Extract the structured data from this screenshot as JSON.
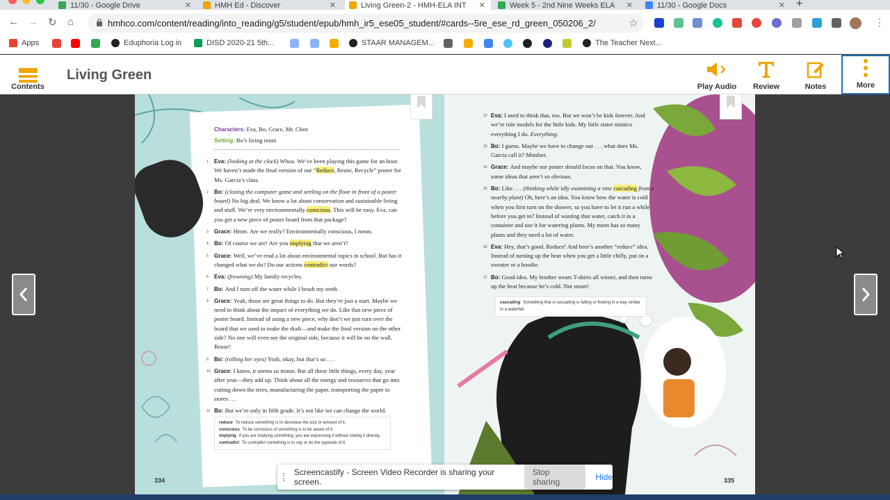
{
  "browser": {
    "tabs": [
      {
        "title": "11/30 - Google Drive",
        "favicon_color": "#34a853"
      },
      {
        "title": "HMH Ed - Discover",
        "favicon_color": "#f0a500"
      },
      {
        "title": "Living Green-2 - HMH-ELA INT",
        "favicon_color": "#f0a500"
      },
      {
        "title": "Week 5 - 2nd Nine Weeks ELA",
        "favicon_color": "#34a853"
      },
      {
        "title": "11/30 - Google Docs",
        "favicon_color": "#4285f4"
      }
    ],
    "active_tab_index": 2,
    "url": "hmhco.com/content/reading/into_reading/g5/student/epub/hmh_ir5_ese05_student/#cards--5re_ese_rd_green_050206_2/",
    "bookmarks": [
      {
        "label": "Apps",
        "icon_color": "#ea4335"
      },
      {
        "label": "Eduphoria Log in",
        "icon_color": "#202124"
      },
      {
        "label": "DISD 2020-21 5th...",
        "icon_color": "#0f9d58"
      },
      {
        "label": "STAAR MANAGEM...",
        "icon_color": "#202124"
      },
      {
        "label": "The Teacher Next...",
        "icon_color": "#202124"
      }
    ]
  },
  "app": {
    "title": "Living Green",
    "contents_label": "Contents",
    "play_audio_label": "Play Audio",
    "review_label": "Review",
    "notes_label": "Notes",
    "more_label": "More",
    "accent_color": "#f0a500"
  },
  "left_page": {
    "characters_label": "Characters:",
    "characters": "Eva, Bo, Grace, Mr. Chen",
    "setting_label": "Setting:",
    "setting": "Bo’s living room",
    "page_number": "334",
    "glossary": [
      {
        "term": "reduce",
        "def": "To reduce something is to decrease the size or amount of it."
      },
      {
        "term": "conscious",
        "def": "To be conscious of something is to be aware of it."
      },
      {
        "term": "implying",
        "def": "If you are implying something, you are expressing it without stating it directly."
      },
      {
        "term": "contradict",
        "def": "To contradict something is to say or do the opposite of it."
      }
    ],
    "lines": [
      {
        "n": "1",
        "speaker": "Eva:",
        "parts": [
          [
            "i",
            "(looking at the clock)"
          ],
          [
            "t",
            " Whoa. We’ve been playing this game for an hour. We haven’t made the final version of our “"
          ],
          [
            "h",
            "Reduce"
          ],
          [
            "t",
            ", Reuse, Recycle” poster for Ms. Garcia’s class."
          ]
        ]
      },
      {
        "n": "2",
        "speaker": "Bo:",
        "parts": [
          [
            "i",
            "(closing the computer game and settling on the floor in front of a poster board)"
          ],
          [
            "t",
            " No big deal. We know a lot about conservation and sustainable living and stuff. We’re very environmentally "
          ],
          [
            "h",
            "conscious"
          ],
          [
            "t",
            ". This will be easy. Eva, can you get a new piece of poster board from that package?"
          ]
        ]
      },
      {
        "n": "3",
        "speaker": "Grace:",
        "parts": [
          [
            "t",
            "Hmm. Are we really? Environmentally conscious, I mean."
          ]
        ]
      },
      {
        "n": "4",
        "speaker": "Bo:",
        "parts": [
          [
            "t",
            "Of course we are! Are you "
          ],
          [
            "h",
            "implying"
          ],
          [
            "t",
            " that we aren’t?"
          ]
        ]
      },
      {
        "n": "5",
        "speaker": "Grace:",
        "parts": [
          [
            "t",
            "Well, we’ve read a lot about environmental topics in school. But has it changed what we do? Do our actions "
          ],
          [
            "h",
            "contradict"
          ],
          [
            "t",
            " our words?"
          ]
        ]
      },
      {
        "n": "6",
        "speaker": "Eva:",
        "parts": [
          [
            "i",
            "(frowning)"
          ],
          [
            "t",
            " My family recycles."
          ]
        ]
      },
      {
        "n": "7",
        "speaker": "Bo:",
        "parts": [
          [
            "t",
            "And I turn off the water while I brush my teeth."
          ]
        ]
      },
      {
        "n": "8",
        "speaker": "Grace:",
        "parts": [
          [
            "t",
            "Yeah, those are great things to do. But they’re just a start. Maybe we need to think about the impact of everything we do. Like that new piece of poster board. Instead of using a new piece, why don’t we just turn over the board that we used to make the draft—and make the final version on the other side? No one will even see the original side, because it will be on the wall. Reuse!"
          ]
        ]
      },
      {
        "n": "9",
        "speaker": "Bo:",
        "parts": [
          [
            "i",
            "(rolling her eyes)"
          ],
          [
            "t",
            " Yeah, okay, but that’s so . . ."
          ]
        ]
      },
      {
        "n": "10",
        "speaker": "Grace:",
        "parts": [
          [
            "t",
            "I know, it seems so minor. But all these little things, every day, year after year—they add up. Think about all the energy and resources that go into cutting down the trees, manufacturing the paper, transporting the paper to stores . . ."
          ]
        ]
      },
      {
        "n": "11",
        "speaker": "Bo:",
        "parts": [
          [
            "t",
            "But we’re only in fifth grade. It’s not like we can change the world."
          ]
        ]
      }
    ]
  },
  "right_page": {
    "page_number": "335",
    "glossary": [
      {
        "term": "cascading",
        "def": "Something that is cascading is falling or flowing in a way similar to a waterfall."
      }
    ],
    "lines": [
      {
        "n": "12",
        "speaker": "Eva:",
        "parts": [
          [
            "t",
            "I used to think that, too. But we won’t be kids forever. And we’re role models for the little kids. My little sister mimics everything I do. "
          ],
          [
            "i",
            "Everything."
          ]
        ]
      },
      {
        "n": "13",
        "speaker": "Bo:",
        "parts": [
          [
            "t",
            "I guess. Maybe we have to change our . . . what does Ms. Garcia call it? Mindset."
          ]
        ]
      },
      {
        "n": "14",
        "speaker": "Grace:",
        "parts": [
          [
            "t",
            "And maybe our poster should focus on that. You know, some ideas that aren’t so obvious."
          ]
        ]
      },
      {
        "n": "15",
        "speaker": "Bo:",
        "parts": [
          [
            "t",
            "Like . . . "
          ],
          [
            "i",
            "(thinking while idly examining a vine "
          ],
          [
            "h",
            "cascading"
          ],
          [
            "i",
            " from a nearby plant)"
          ],
          [
            "t",
            " Oh, here’s an idea. You know how the water is cold when you first turn on the shower, so you have to let it run a while before you get in? Instead of wasting that water, catch it in a container and use it for watering plants. My mom has "
          ],
          [
            "i",
            "so"
          ],
          [
            "t",
            " many plants and they need a lot of water."
          ]
        ]
      },
      {
        "n": "16",
        "speaker": "Eva:",
        "parts": [
          [
            "t",
            "Hey, that’s good. Reduce! And here’s another “reduce” idea. Instead of turning up the heat when you get a little chilly, put on a sweater or a hoodie."
          ]
        ]
      },
      {
        "n": "17",
        "speaker": "Bo:",
        "parts": [
          [
            "t",
            "Good idea. My brother wears T-shirts all winter, and then turns up the heat because he’s cold. Not smart!"
          ]
        ]
      }
    ]
  },
  "share_notice": {
    "message": "Screencastify - Screen Video Recorder is sharing your screen.",
    "stop_label": "Stop sharing",
    "hide_label": "Hide"
  }
}
